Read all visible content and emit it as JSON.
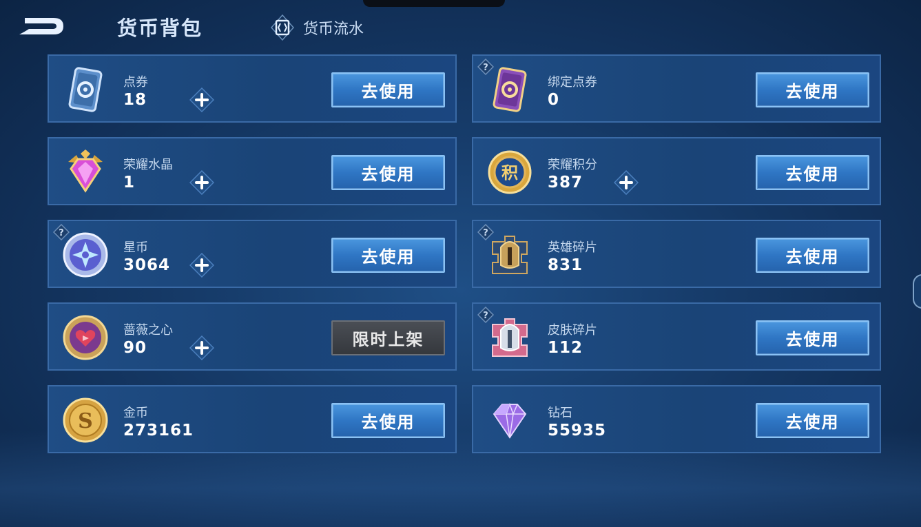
{
  "header": {
    "title": "货币背包",
    "flow_link": "货币流水"
  },
  "cards": [
    {
      "name": "点券",
      "amount": "18",
      "button": "去使用",
      "has_plus": true,
      "has_help": false,
      "icon": "ticket-icon"
    },
    {
      "name": "绑定点券",
      "amount": "0",
      "button": "去使用",
      "has_plus": false,
      "has_help": true,
      "icon": "bound-ticket-icon"
    },
    {
      "name": "荣耀水晶",
      "amount": "1",
      "button": "去使用",
      "has_plus": true,
      "has_help": false,
      "icon": "glory-crystal-icon"
    },
    {
      "name": "荣耀积分",
      "amount": "387",
      "button": "去使用",
      "has_plus": true,
      "has_help": false,
      "icon": "glory-points-icon"
    },
    {
      "name": "星币",
      "amount": "3064",
      "button": "去使用",
      "has_plus": true,
      "has_help": true,
      "icon": "star-coin-icon"
    },
    {
      "name": "英雄碎片",
      "amount": "831",
      "button": "去使用",
      "has_plus": false,
      "has_help": true,
      "icon": "hero-fragment-icon"
    },
    {
      "name": "蔷薇之心",
      "amount": "90",
      "button": "限时上架",
      "has_plus": true,
      "has_help": false,
      "icon": "rose-heart-icon"
    },
    {
      "name": "皮肤碎片",
      "amount": "112",
      "button": "去使用",
      "has_plus": false,
      "has_help": true,
      "icon": "skin-fragment-icon"
    },
    {
      "name": "金币",
      "amount": "273161",
      "button": "去使用",
      "has_plus": false,
      "has_help": false,
      "icon": "gold-coin-icon"
    },
    {
      "name": "钻石",
      "amount": "55935",
      "button": "去使用",
      "has_plus": false,
      "has_help": false,
      "icon": "diamond-icon"
    }
  ],
  "colors": {
    "background": "#173d6c",
    "card_border": "#3a6aa6",
    "button_blue": "#2f76c4",
    "button_disabled": "#3a3d42"
  }
}
